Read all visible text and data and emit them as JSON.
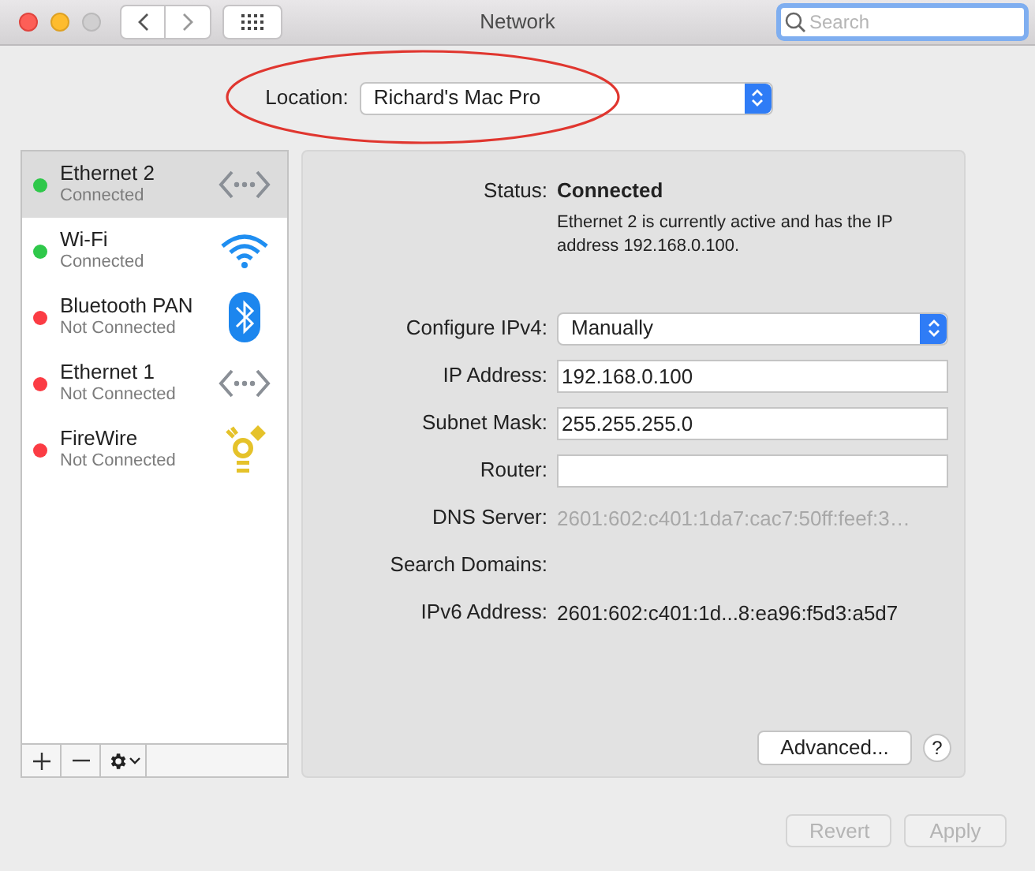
{
  "window": {
    "title": "Network"
  },
  "search": {
    "placeholder": "Search"
  },
  "location": {
    "label": "Location:",
    "value": "Richard's Mac Pro"
  },
  "services": [
    {
      "name": "Ethernet 2",
      "status": "Connected",
      "color": "#2fc84a",
      "kind": "ethernet",
      "selected": true
    },
    {
      "name": "Wi-Fi",
      "status": "Connected",
      "color": "#2fc84a",
      "kind": "wifi",
      "selected": false
    },
    {
      "name": "Bluetooth PAN",
      "status": "Not Connected",
      "color": "#fb3c44",
      "kind": "bluetooth",
      "selected": false
    },
    {
      "name": "Ethernet 1",
      "status": "Not Connected",
      "color": "#fb3c44",
      "kind": "ethernet",
      "selected": false
    },
    {
      "name": "FireWire",
      "status": "Not Connected",
      "color": "#fb3c44",
      "kind": "firewire",
      "selected": false
    }
  ],
  "status": {
    "label": "Status:",
    "value": "Connected",
    "description": "Ethernet 2 is currently active and has the IP address 192.168.0.100."
  },
  "fields": [
    {
      "kind": "select",
      "label": "Configure IPv4:",
      "value": "Manually"
    },
    {
      "kind": "input",
      "label": "IP Address:",
      "value": "192.168.0.100"
    },
    {
      "kind": "input",
      "label": "Subnet Mask:",
      "value": "255.255.255.0"
    },
    {
      "kind": "input",
      "label": "Router:"
    },
    {
      "kind": "text",
      "label": "DNS Server:",
      "value": "2601:602:c401:1da7:cac7:50ff:feef:3…",
      "dimmed": true
    },
    {
      "kind": "text",
      "label": "Search Domains:"
    },
    {
      "kind": "text",
      "label": "IPv6 Address:",
      "value": "2601:602:c401:1d...8:ea96:f5d3:a5d7",
      "dimmed": false
    }
  ],
  "advanced_button": {
    "label": "Advanced..."
  },
  "help_button": {
    "label": "?"
  },
  "footer_buttons": [
    {
      "label": "Revert",
      "disabled": true
    },
    {
      "label": "Apply",
      "disabled": true
    }
  ]
}
